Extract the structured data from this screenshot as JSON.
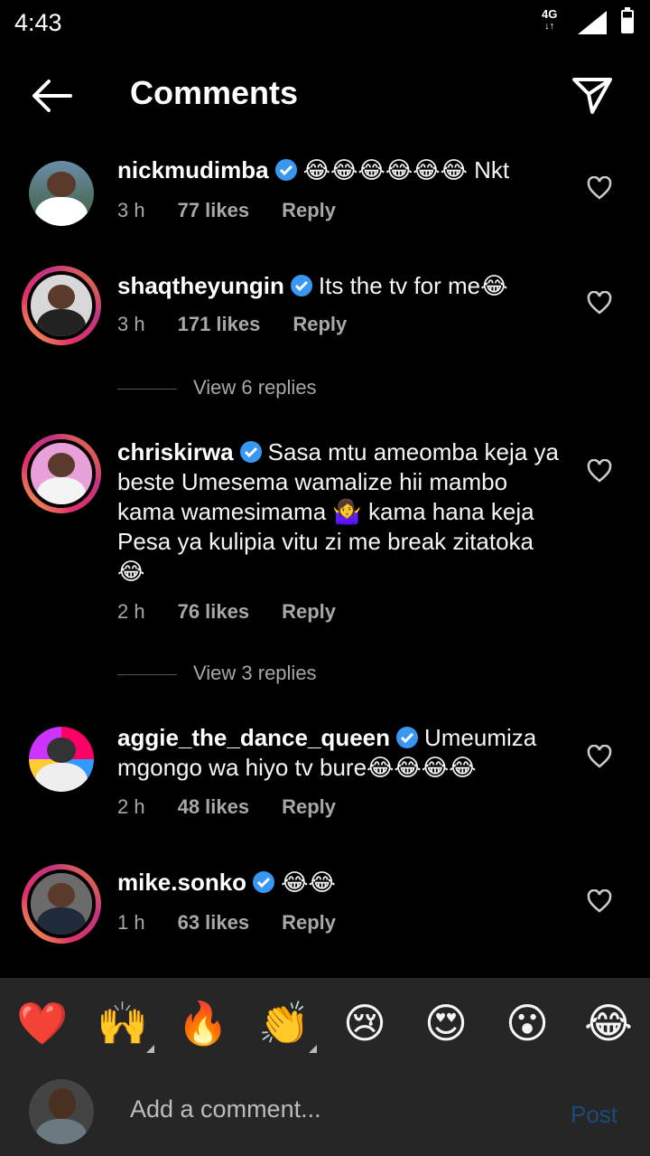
{
  "status_bar": {
    "time": "4:43",
    "network": "4G"
  },
  "header": {
    "title": "Comments",
    "back_icon": "arrow-left-icon",
    "share_icon": "paper-plane-icon"
  },
  "comments": [
    {
      "username": "nickmudimba",
      "text": "😂😂😂😂😂😂 Nkt",
      "time": "3 h",
      "likes": "77 likes",
      "reply": "Reply"
    },
    {
      "username": "shaqtheyungin",
      "text": "Its the tv for me😂",
      "time": "3 h",
      "likes": "171 likes",
      "reply": "Reply",
      "view_replies": "View 6 replies"
    },
    {
      "username": "chriskirwa",
      "text": "Sasa mtu ameomba keja ya beste Umesema wamalize hii mambo kama wamesimama 🤷‍♀️ kama hana keja Pesa ya kulipia vitu zi me break zitatoka 😂",
      "time": "2 h",
      "likes": "76 likes",
      "reply": "Reply",
      "view_replies": "View 3 replies"
    },
    {
      "username": "aggie_the_dance_queen",
      "text": "Umeumiza mgongo wa hiyo tv bure😂😂😂😂",
      "time": "2 h",
      "likes": "48 likes",
      "reply": "Reply"
    },
    {
      "username": "mike.sonko",
      "text": "😂😂",
      "time": "1 h",
      "likes": "63 likes",
      "reply": "Reply"
    }
  ],
  "reactions": [
    "❤️",
    "🙌",
    "🔥",
    "👏",
    "😢",
    "😍",
    "😮",
    "😂"
  ],
  "composer": {
    "placeholder": "Add a comment...",
    "post_label": "Post"
  },
  "colors": {
    "background": "#000000",
    "secondary_text": "#a8a8a8",
    "verified": "#3897f0",
    "post_disabled": "#1a4b7e",
    "bar": "#262626"
  }
}
